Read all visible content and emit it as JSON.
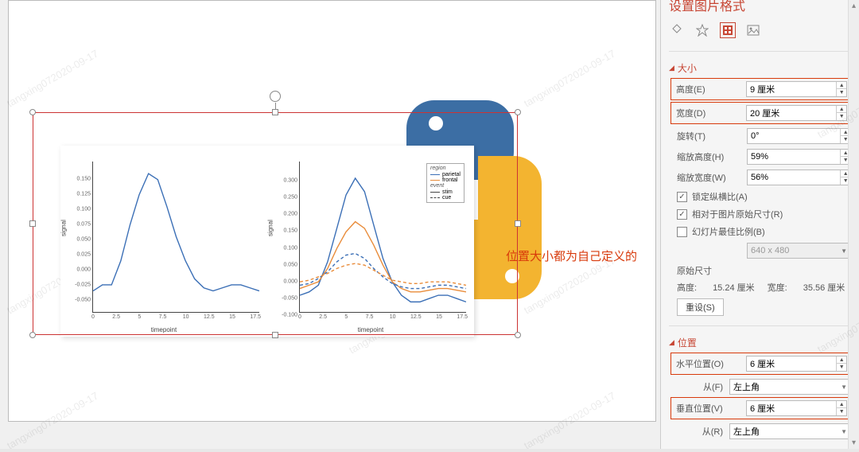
{
  "panel_title": "设置图片格式",
  "sections": {
    "size": {
      "header": "大小",
      "height_label": "高度(E)",
      "height_value": "9 厘米",
      "width_label": "宽度(D)",
      "width_value": "20 厘米",
      "rotate_label": "旋转(T)",
      "rotate_value": "0°",
      "scale_h_label": "缩放高度(H)",
      "scale_h_value": "59%",
      "scale_w_label": "缩放宽度(W)",
      "scale_w_value": "56%",
      "lock_aspect": "锁定纵横比(A)",
      "rel_original": "相对于图片原始尺寸(R)",
      "best_fit": "幻灯片最佳比例(B)",
      "resolution_value": "640 x 480",
      "orig_size_label": "原始尺寸",
      "orig_h_label": "高度:",
      "orig_h_value": "15.24 厘米",
      "orig_w_label": "宽度:",
      "orig_w_value": "35.56 厘米",
      "reset_label": "重设(S)"
    },
    "position": {
      "header": "位置",
      "hpos_label": "水平位置(O)",
      "hpos_value": "6 厘米",
      "from_label_h": "从(F)",
      "from_value_h": "左上角",
      "vpos_label": "垂直位置(V)",
      "vpos_value": "6 厘米",
      "from_label_v": "从(R)",
      "from_value_v": "左上角"
    }
  },
  "annotation": "位置大小都为自己定义的",
  "watermark_text": "tangxing072020-09-17",
  "chart_data": [
    {
      "type": "line",
      "title": "",
      "xlabel": "timepoint",
      "ylabel": "signal",
      "xlim": [
        0,
        18
      ],
      "ylim": [
        -0.075,
        0.175
      ],
      "xticks": [
        0,
        2.5,
        5,
        7.5,
        10,
        12.5,
        15,
        17.5
      ],
      "yticks": [
        -0.05,
        -0.025,
        0.0,
        0.025,
        0.05,
        0.075,
        0.1,
        0.125,
        0.15
      ],
      "series": [
        {
          "name": "signal",
          "color": "#3b6fb6",
          "x": [
            0,
            1,
            2,
            3,
            4,
            5,
            6,
            7,
            8,
            9,
            10,
            11,
            12,
            13,
            14,
            15,
            16,
            17,
            18
          ],
          "y": [
            -0.04,
            -0.03,
            -0.03,
            0.01,
            0.07,
            0.12,
            0.155,
            0.145,
            0.1,
            0.05,
            0.01,
            -0.02,
            -0.035,
            -0.04,
            -0.035,
            -0.03,
            -0.03,
            -0.035,
            -0.04
          ]
        }
      ]
    },
    {
      "type": "line",
      "title": "",
      "xlabel": "timepoint",
      "ylabel": "signal",
      "xlim": [
        0,
        18
      ],
      "ylim": [
        -0.1,
        0.35
      ],
      "xticks": [
        0,
        2.5,
        5,
        7.5,
        10,
        12.5,
        15,
        17.5
      ],
      "yticks": [
        -0.1,
        -0.05,
        0.0,
        0.05,
        0.1,
        0.15,
        0.2,
        0.25,
        0.3
      ],
      "legend": {
        "groups": [
          {
            "title": "region",
            "items": [
              {
                "name": "parietal",
                "color": "#3b6fb6",
                "dash": "solid"
              },
              {
                "name": "frontal",
                "color": "#e98c3a",
                "dash": "solid"
              }
            ]
          },
          {
            "title": "event",
            "items": [
              {
                "name": "stim",
                "color": "#444",
                "dash": "solid"
              },
              {
                "name": "cue",
                "color": "#444",
                "dash": "dashed"
              }
            ]
          }
        ]
      },
      "series": [
        {
          "name": "parietal-stim",
          "color": "#3b6fb6",
          "dash": "solid",
          "x": [
            0,
            1,
            2,
            3,
            4,
            5,
            6,
            7,
            8,
            9,
            10,
            11,
            12,
            13,
            14,
            15,
            16,
            17,
            18
          ],
          "y": [
            -0.05,
            -0.04,
            -0.02,
            0.05,
            0.15,
            0.25,
            0.3,
            0.26,
            0.16,
            0.06,
            -0.01,
            -0.05,
            -0.07,
            -0.07,
            -0.06,
            -0.05,
            -0.05,
            -0.06,
            -0.07
          ]
        },
        {
          "name": "frontal-stim",
          "color": "#e98c3a",
          "dash": "solid",
          "x": [
            0,
            1,
            2,
            3,
            4,
            5,
            6,
            7,
            8,
            9,
            10,
            11,
            12,
            13,
            14,
            15,
            16,
            17,
            18
          ],
          "y": [
            -0.03,
            -0.02,
            -0.01,
            0.03,
            0.09,
            0.14,
            0.17,
            0.15,
            0.1,
            0.04,
            -0.01,
            -0.03,
            -0.04,
            -0.04,
            -0.035,
            -0.03,
            -0.03,
            -0.035,
            -0.04
          ]
        },
        {
          "name": "parietal-cue",
          "color": "#3b6fb6",
          "dash": "dashed",
          "x": [
            0,
            1,
            2,
            3,
            4,
            5,
            6,
            7,
            8,
            9,
            10,
            11,
            12,
            13,
            14,
            15,
            16,
            17,
            18
          ],
          "y": [
            -0.02,
            -0.015,
            0.0,
            0.02,
            0.05,
            0.07,
            0.075,
            0.06,
            0.03,
            0.005,
            -0.015,
            -0.025,
            -0.03,
            -0.03,
            -0.025,
            -0.02,
            -0.02,
            -0.025,
            -0.03
          ]
        },
        {
          "name": "frontal-cue",
          "color": "#e98c3a",
          "dash": "dashed",
          "x": [
            0,
            1,
            2,
            3,
            4,
            5,
            6,
            7,
            8,
            9,
            10,
            11,
            12,
            13,
            14,
            15,
            16,
            17,
            18
          ],
          "y": [
            -0.01,
            -0.005,
            0.005,
            0.015,
            0.03,
            0.04,
            0.045,
            0.04,
            0.025,
            0.01,
            -0.005,
            -0.01,
            -0.015,
            -0.015,
            -0.01,
            -0.01,
            -0.01,
            -0.015,
            -0.02
          ]
        }
      ]
    }
  ]
}
